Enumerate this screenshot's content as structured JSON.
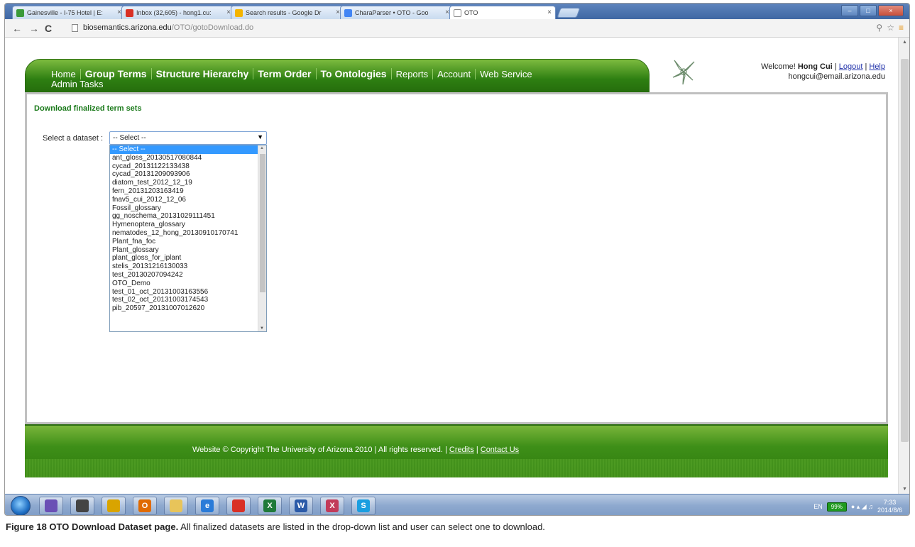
{
  "browser": {
    "tabs": [
      {
        "label": "Gainesville - I-75 Hotel | E:",
        "fav_color": "#3a9a3a"
      },
      {
        "label": "Inbox (32,605) - hong1.cu:",
        "fav_color": "#d93025"
      },
      {
        "label": "Search results - Google Dr",
        "fav_color": "#f4b400"
      },
      {
        "label": "CharaParser • OTO - Goo",
        "fav_color": "#4285f4"
      },
      {
        "label": "OTO",
        "fav_color": "#ffffff"
      }
    ],
    "address_host": "biosemantics.arizona.edu",
    "address_path": "/OTO/gotoDownload.do"
  },
  "site": {
    "nav_items": [
      {
        "label": "Home",
        "bold": false
      },
      {
        "label": "Group Terms",
        "bold": true
      },
      {
        "label": "Structure Hierarchy",
        "bold": true
      },
      {
        "label": "Term Order",
        "bold": true
      },
      {
        "label": "To Ontologies",
        "bold": true
      },
      {
        "label": "Reports",
        "bold": false
      },
      {
        "label": "Account",
        "bold": false
      },
      {
        "label": "Web Service",
        "bold": false
      }
    ],
    "admin_tasks": "Admin Tasks",
    "welcome_prefix": "Welcome!",
    "user_name": "Hong Cui",
    "logout": "Logout",
    "help": "Help",
    "sep": "|",
    "user_email": "hongcui@email.arizona.edu"
  },
  "content": {
    "title": "Download finalized term sets",
    "dataset_label": "Select a dataset :",
    "select_value": "-- Select --",
    "options": [
      "-- Select --",
      "ant_gloss_20130517080844",
      "cycad_20131122133438",
      "cycad_20131209093906",
      "diatom_test_2012_12_19",
      "fern_20131203163419",
      "fnav5_cui_2012_12_06",
      "Fossil_glossary",
      "gg_noschema_20131029111451",
      "Hymenoptera_glossary",
      "nematodes_12_hong_20130910170741",
      "Plant_fna_foc",
      "Plant_glossary",
      "plant_gloss_for_iplant",
      "stelis_20131216130033",
      "test_20130207094242",
      "OTO_Demo",
      "test_01_oct_20131003163556",
      "test_02_oct_20131003174543",
      "pib_20597_20131007012620"
    ]
  },
  "footer": {
    "copyright": "Website © Copyright The University of Arizona 2010 | All rights reserved. |",
    "credits": "Credits",
    "contact": "Contact Us"
  },
  "taskbar": {
    "apps": [
      {
        "icon": "firefox-icon",
        "color": "#6a4fb5",
        "glyph": ""
      },
      {
        "icon": "clock-icon",
        "color": "#444444",
        "glyph": ""
      },
      {
        "icon": "chart-app-icon",
        "color": "#d9a400",
        "glyph": ""
      },
      {
        "icon": "outlook-icon",
        "color": "#e06a00",
        "glyph": "O"
      },
      {
        "icon": "folder-icon",
        "color": "#e8c45a",
        "glyph": ""
      },
      {
        "icon": "ie-icon",
        "color": "#2a7bd8",
        "glyph": "e"
      },
      {
        "icon": "chrome-icon",
        "color": "#d93025",
        "glyph": ""
      },
      {
        "icon": "excel-icon",
        "color": "#1f7a3a",
        "glyph": "X"
      },
      {
        "icon": "word-icon",
        "color": "#2b5aa8",
        "glyph": "W"
      },
      {
        "icon": "xmind-icon",
        "color": "#c23b5a",
        "glyph": "X"
      },
      {
        "icon": "skype-icon",
        "color": "#1a9ee0",
        "glyph": "S"
      }
    ],
    "lang": "EN",
    "battery": "99%",
    "time": "7:33",
    "date": "2014/8/6"
  },
  "caption": {
    "label": "Figure 18 OTO Download Dataset page.",
    "text": "All finalized datasets are listed in the drop-down list and user can select one to download."
  }
}
